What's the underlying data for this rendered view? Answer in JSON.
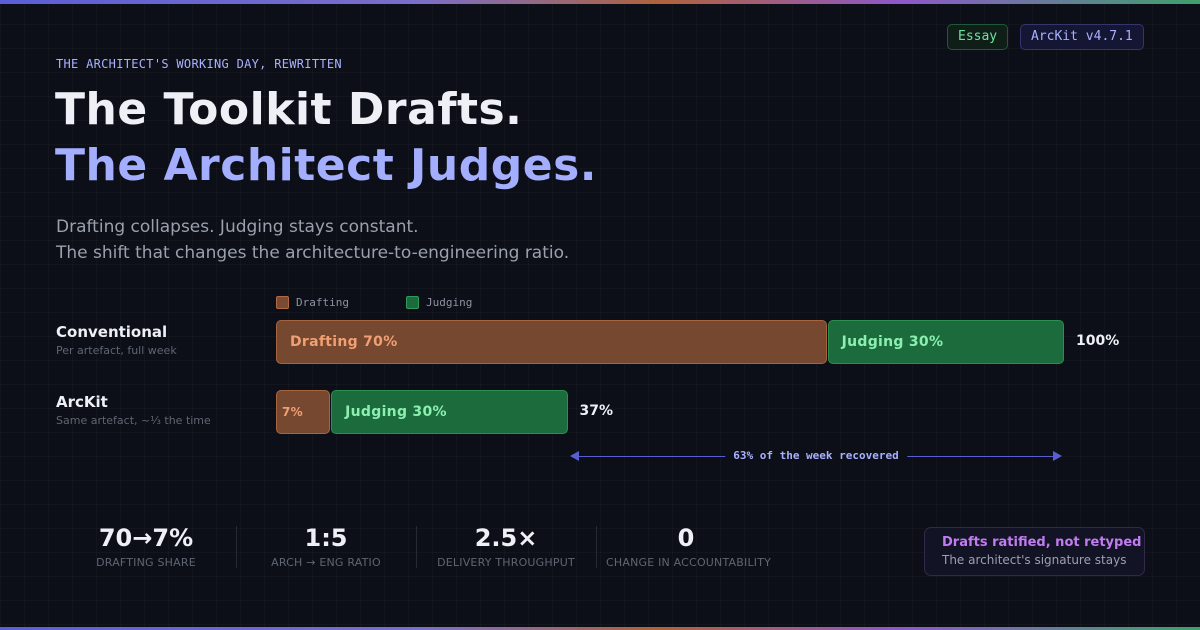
{
  "badges": {
    "essay": "Essay",
    "version": "ArcKit v4.7.1"
  },
  "eyebrow": "THE ARCHITECT'S WORKING DAY, REWRITTEN",
  "headline": {
    "line1": "The Toolkit Drafts.",
    "line2": "The Architect Judges."
  },
  "subtitle": {
    "line1": "Drafting collapses. Judging stays constant.",
    "line2": "The shift that changes the architecture-to-engineering ratio."
  },
  "legend": {
    "drafting": "Drafting",
    "judging": "Judging"
  },
  "rows": [
    {
      "name": "Conventional",
      "desc": "Per artefact, full week",
      "drafting_pct": 70,
      "judging_pct": 30,
      "drafting_label": "Drafting  70%",
      "judging_label": "Judging  30%",
      "total_label": "100%"
    },
    {
      "name": "ArcKit",
      "desc": "Same artefact, ~⅓ the time",
      "drafting_pct": 7,
      "judging_pct": 30,
      "drafting_label": "7%",
      "judging_label": "Judging  30%",
      "total_label": "37%"
    }
  ],
  "recovered_label": "63% of the week recovered",
  "stats": [
    {
      "value": "70→7%",
      "label": "DRAFTING SHARE"
    },
    {
      "value": "1:5",
      "label": "ARCH → ENG RATIO"
    },
    {
      "value": "2.5×",
      "label": "DELIVERY THROUGHPUT"
    },
    {
      "value": "0",
      "label": "CHANGE IN ACCOUNTABILITY"
    }
  ],
  "callout": {
    "title": "Drafts ratified, not retyped",
    "subtitle": "The architect's signature stays"
  },
  "colors": {
    "drafting": "#774830",
    "judging": "#1b6b3c",
    "accent": "#a3aeff",
    "callout_title": "#c27bf0"
  }
}
